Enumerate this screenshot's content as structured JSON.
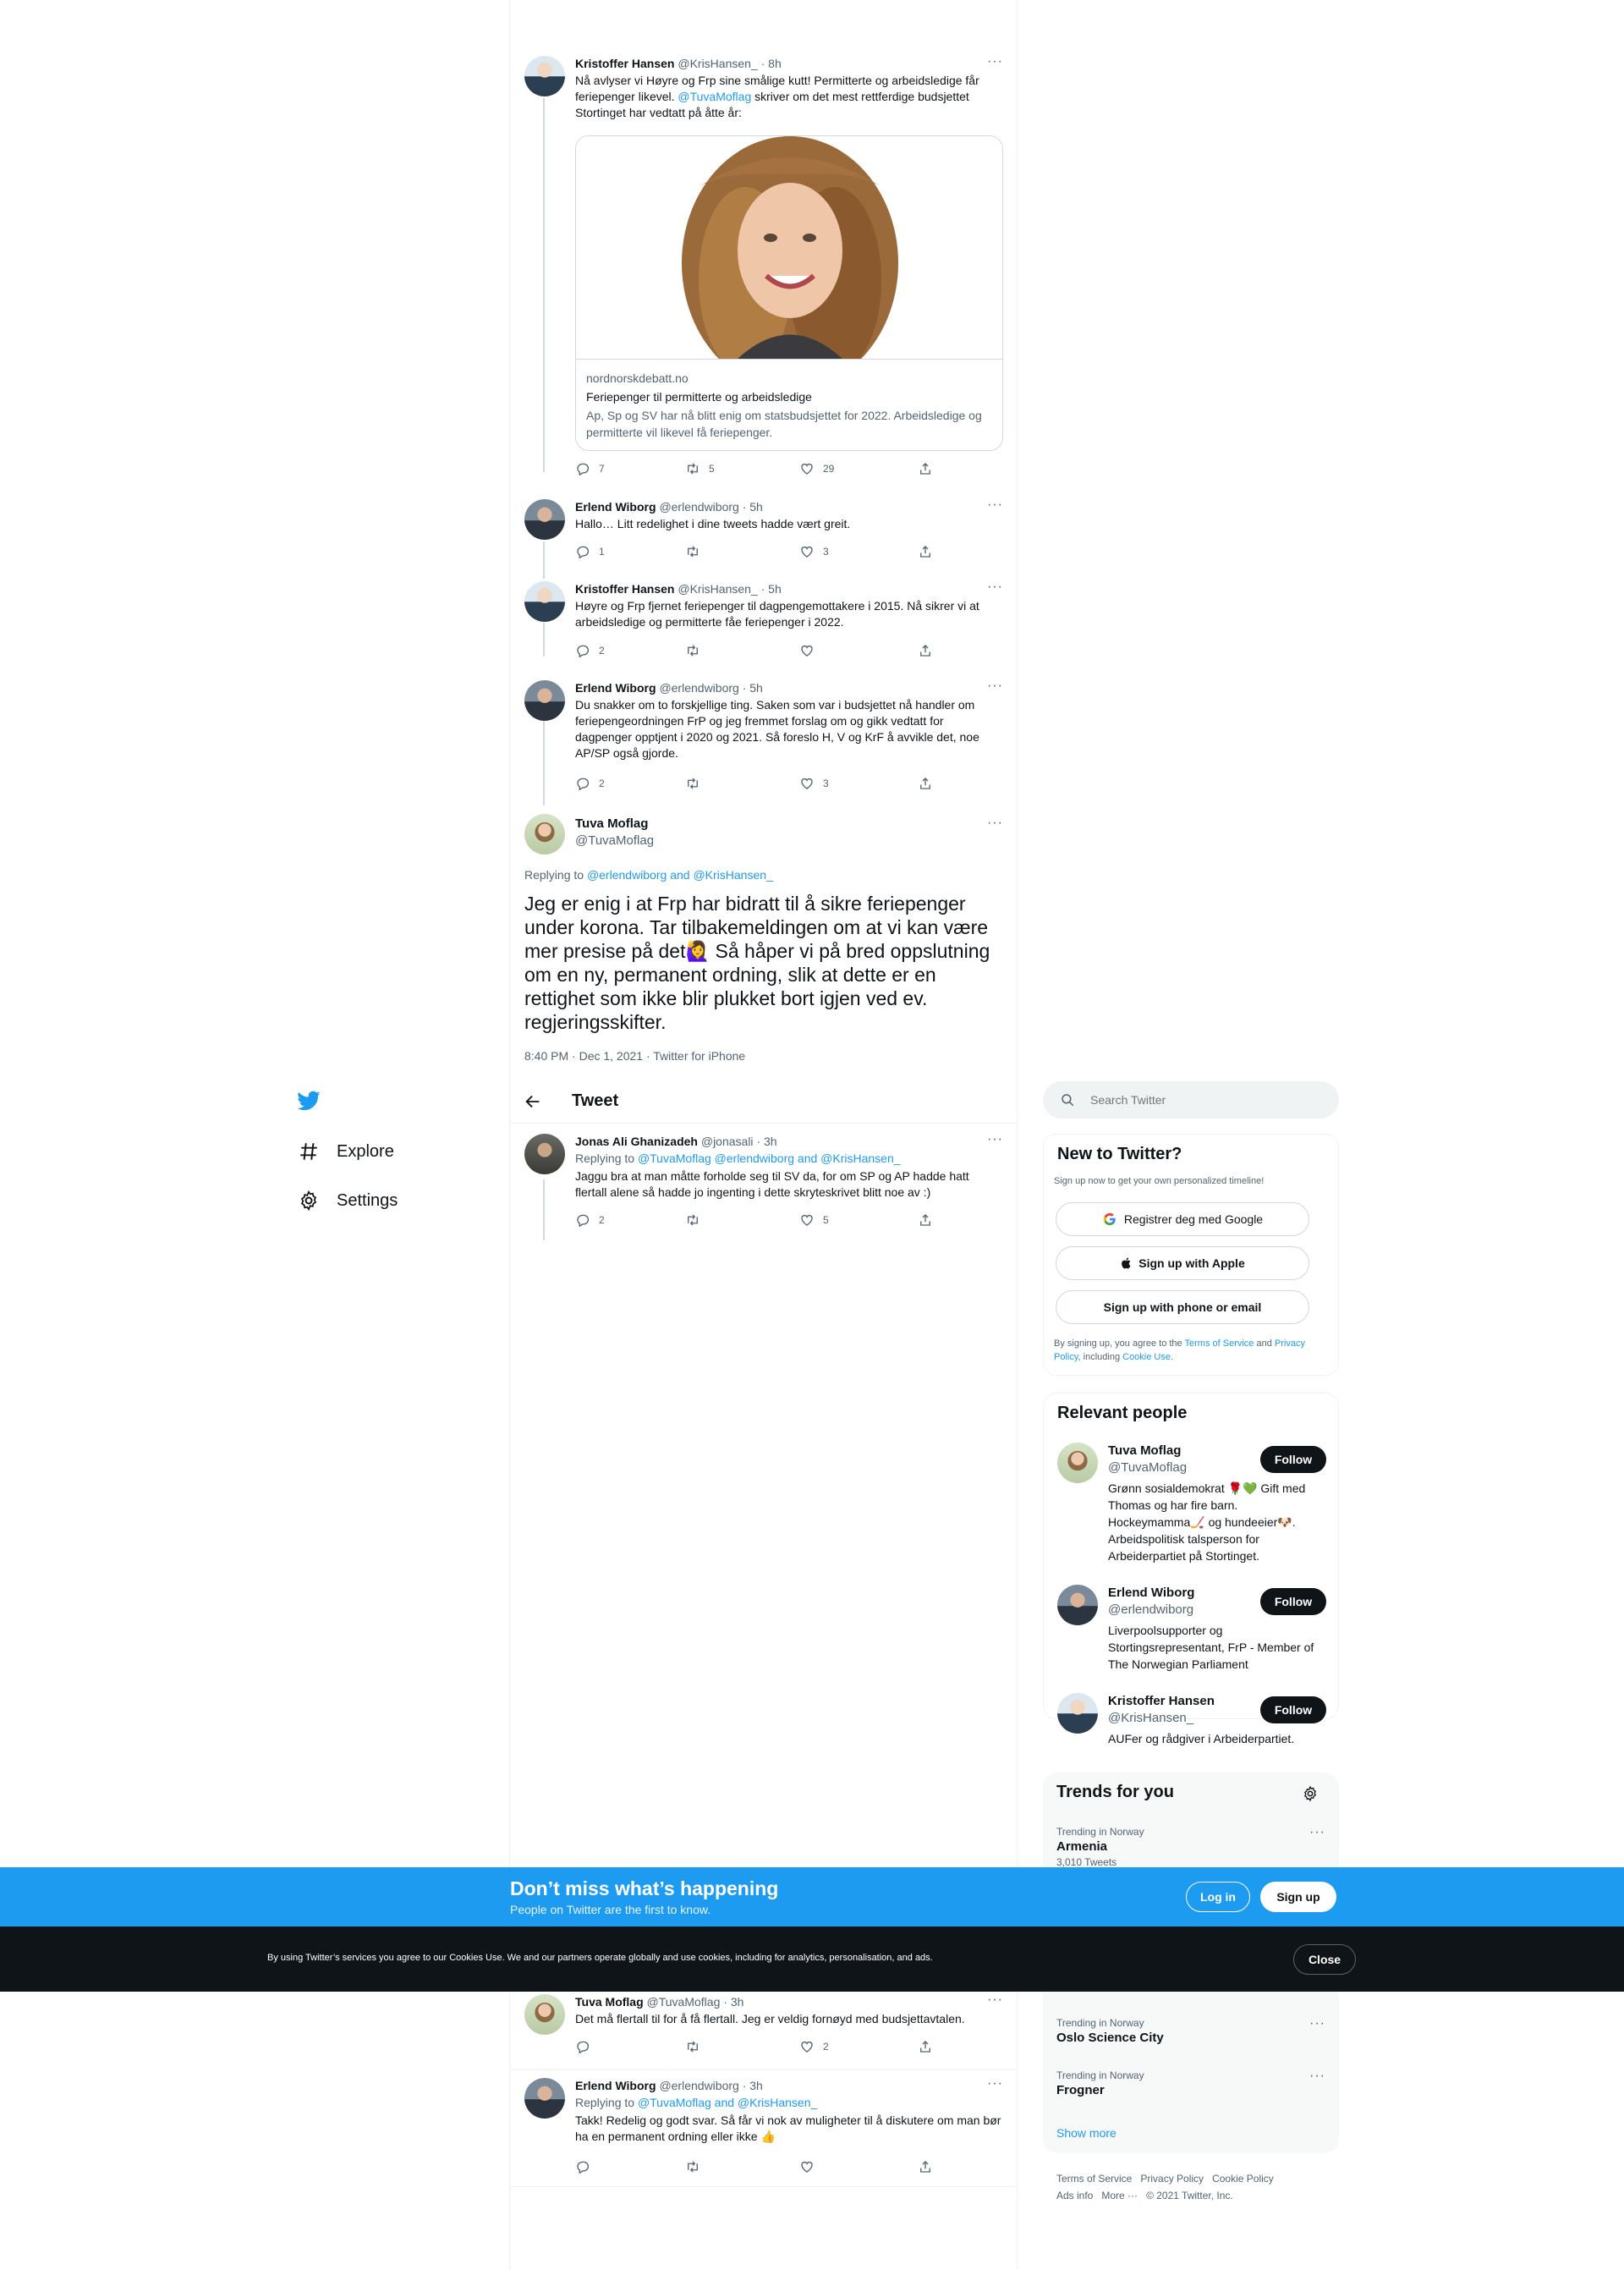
{
  "thread": [
    {
      "author": "Kristoffer Hansen",
      "handle": "@KrisHansen_",
      "time": "· 8h",
      "text_before": "Nå avlyser vi Høyre og Frp sine smålige kutt! Permitterte og arbeidsledige får feriepenger likevel. ",
      "mention": "@TuvaMoflag",
      "text_after": " skriver om det mest rettferdige budsjettet Stortinget har vedtatt på åtte år:",
      "card": {
        "domain": "nordnorskdebatt.no",
        "title": "Feriepenger til permitterte og arbeidsledige",
        "description": "Ap, Sp og SV har nå blitt enig om statsbudsjettet for 2022. Arbeidsledige og permitterte vil likevel få feriepenger."
      },
      "replies": "7",
      "retweets": "5",
      "likes": "29"
    },
    {
      "author": "Erlend Wiborg",
      "handle": "@erlendwiborg",
      "time": "· 5h",
      "text": "Hallo… Litt redelighet i dine tweets hadde vært greit.",
      "replies": "1",
      "retweets": "",
      "likes": "3"
    },
    {
      "author": "Kristoffer Hansen",
      "handle": "@KrisHansen_",
      "time": "· 5h",
      "text": "Høyre og Frp fjernet feriepenger til dagpengemottakere i 2015. Nå sikrer vi at arbeidsledige og permitterte fåe feriepenger i 2022.",
      "replies": "2",
      "retweets": "",
      "likes": ""
    },
    {
      "author": "Erlend Wiborg",
      "handle": "@erlendwiborg",
      "time": "· 5h",
      "text": "Du snakker om to forskjellige ting. Saken som var i budsjettet nå handler om feriepengeordningen FrP og jeg fremmet forslag om og gikk vedtatt for dagpenger opptjent i 2020 og 2021. Så foreslo H, V og KrF å avvikle det, noe AP/SP også gjorde.",
      "replies": "2",
      "retweets": "",
      "likes": "3"
    }
  ],
  "main_tweet": {
    "author": "Tuva Moflag",
    "handle": "@TuvaMoflag",
    "replying_label": "Replying to ",
    "replying_to": "@erlendwiborg and @KrisHansen_",
    "text": "Jeg er enig i at Frp har bidratt til å sikre feriepenger under korona. Tar tilbakemeldingen om at vi kan være mer presise på det🙋‍♀️ Så håper vi på bred oppslutning om en ny, permanent ordning, slik at dette er en rettighet som ikke blir plukket bort igjen ved ev. regjeringsskifter.",
    "timestamp": "8:40 PM · Dec 1, 2021 · Twitter for iPhone"
  },
  "header": {
    "title": "Tweet",
    "back_icon": "arrow-left-icon"
  },
  "replies": [
    {
      "author": "Jonas Ali Ghanizadeh",
      "handle": "@jonasali",
      "time": "· 3h",
      "replying_label": "Replying to ",
      "replying_to": "@TuvaMoflag @erlendwiborg and @KrisHansen_",
      "text": "Jaggu bra at man måtte forholde seg til SV da, for om SP og AP hadde hatt flertall alene så hadde jo ingenting i dette skryteskrivet blitt noe av :)",
      "replies": "2",
      "retweets": "",
      "likes": "5"
    },
    {
      "author": "Tuva Moflag",
      "handle": "@TuvaMoflag",
      "time": "· 3h",
      "text": "Det må flertall til for å få flertall. Jeg er veldig fornøyd med budsjettavtalen.",
      "replies": "",
      "retweets": "",
      "likes": "2"
    },
    {
      "author": "Erlend Wiborg",
      "handle": "@erlendwiborg",
      "time": "· 3h",
      "replying_label": "Replying to ",
      "replying_to": "@TuvaMoflag and @KrisHansen_",
      "text": "Takk! Redelig og godt svar. Så får vi nok av muligheter til å diskutere om man bør ha en permanent ordning eller ikke 👍",
      "replies": "",
      "retweets": "",
      "likes": ""
    }
  ],
  "nav": {
    "explore": "Explore",
    "settings": "Settings"
  },
  "search": {
    "placeholder": "Search Twitter"
  },
  "new_to_twitter": {
    "title": "New to Twitter?",
    "subtitle": "Sign up now to get your own personalized timeline!",
    "google": "Registrer deg med Google",
    "apple": "Sign up with Apple",
    "phone": "Sign up with phone or email",
    "terms_1": "By signing up, you agree to the ",
    "terms_link": "Terms of Service",
    "terms_2": " and ",
    "privacy_link": "Privacy Policy",
    "terms_3": ", including ",
    "cookie_link": "Cookie Use",
    "terms_4": "."
  },
  "relevant_people": {
    "title": "Relevant people",
    "follow_label": "Follow",
    "people": [
      {
        "name": "Tuva Moflag",
        "handle": "@TuvaMoflag",
        "bio": "Grønn sosialdemokrat 🌹💚 Gift med Thomas og har fire barn. Hockeymamma🏒 og hundeeier🐶. Arbeidspolitisk talsperson for Arbeiderpartiet på Stortinget."
      },
      {
        "name": "Erlend Wiborg",
        "handle": "@erlendwiborg",
        "bio": "Liverpoolsupporter og Stortingsrepresentant, FrP - Member of The Norwegian Parliament"
      },
      {
        "name": "Kristoffer Hansen",
        "handle": "@KrisHansen_",
        "bio": "AUFer og rådgiver i Arbeiderpartiet."
      }
    ]
  },
  "trends": {
    "title": "Trends for you",
    "items": [
      {
        "context": "Trending in Norway",
        "name": "Armenia",
        "count": "3,010 Tweets"
      },
      {
        "context": "Trending in Norway",
        "name": "Oslo Science City"
      },
      {
        "context": "Trending in Norway",
        "name": "Frogner"
      }
    ],
    "show_more": "Show more"
  },
  "footer": {
    "terms": "Terms of Service",
    "privacy": "Privacy Policy",
    "cookie": "Cookie Policy",
    "ads": "Ads info",
    "more": "More ···",
    "copyright": "© 2021 Twitter, Inc."
  },
  "signup_bar": {
    "title": "Don’t miss what’s happening",
    "subtitle": "People on Twitter are the first to know.",
    "login": "Log in",
    "signup": "Sign up"
  },
  "cookie_bar": {
    "text": "By using Twitter’s services you agree to our Cookies Use. We and our partners operate globally and use cookies, including for analytics, personalisation, and ads.",
    "close": "Close"
  },
  "colors": {
    "accent": "#1d9bf0",
    "text": "#0f1419",
    "muted": "#536471",
    "dark_bar": "#0f1419"
  }
}
